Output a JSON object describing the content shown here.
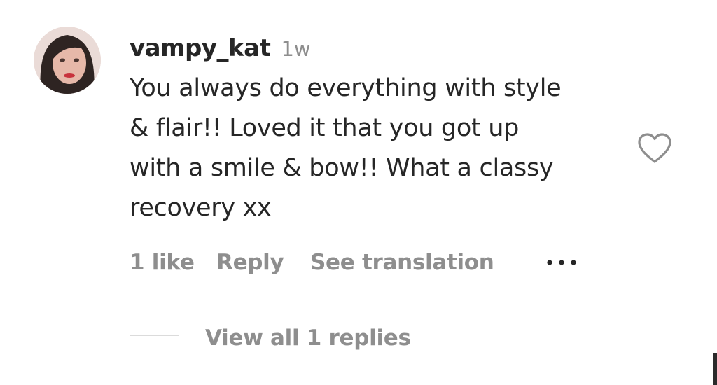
{
  "comment": {
    "username": "vampy_kat",
    "timestamp": "1w",
    "text_lines": [
      "You always do everything with style",
      "& flair!! Loved it that you got up",
      "with a smile & bow!! What a classy",
      "recovery xx"
    ],
    "like_icon": "heart-outline-icon"
  },
  "actions": {
    "likes": "1 like",
    "reply": "Reply",
    "translate": "See translation",
    "more_icon": "ellipsis-icon"
  },
  "replies": {
    "view_label": "View all 1 replies"
  },
  "colors": {
    "text": "#262626",
    "secondary": "#8e8e8e",
    "divider": "#dbdbdb"
  }
}
